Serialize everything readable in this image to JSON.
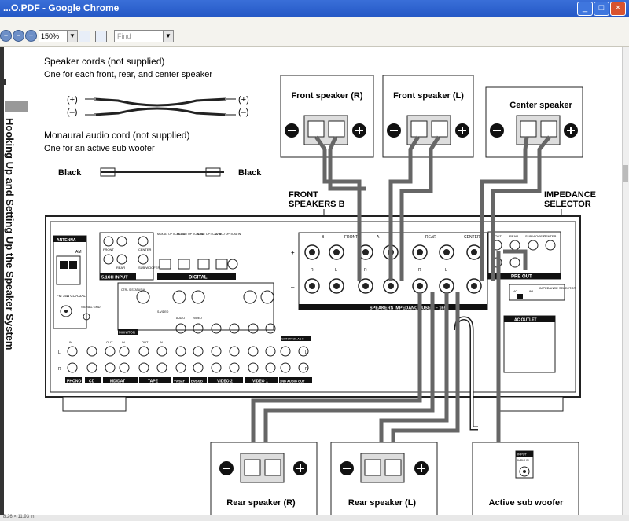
{
  "window": {
    "title": "...O.PDF - Google Chrome",
    "min": "_",
    "max": "□",
    "close": "×"
  },
  "toolbar": {
    "zoom": "150%",
    "find_placeholder": "Find",
    "page_size": "8.26 × 11.93 in"
  },
  "side_heading": "Hooking Up and Setting Up the Speaker System",
  "cords": {
    "speaker_title": "Speaker cords (not supplied)",
    "speaker_desc": "One for each front, rear, and center speaker",
    "plus": "(+)",
    "minus": "(–)",
    "mono_title": "Monaural audio cord (not supplied)",
    "mono_desc": "One for an active sub woofer",
    "black": "Black"
  },
  "speakers": {
    "front_r": "Front speaker (R)",
    "front_l": "Front speaker (L)",
    "center": "Center speaker",
    "rear_r": "Rear speaker (R)",
    "rear_l": "Rear speaker (L)",
    "sub": "Active sub woofer",
    "sub_input": "INPUT",
    "sub_audio": "AUDIO IN"
  },
  "callouts": {
    "front_b_1": "FRONT",
    "front_b_2": "SPEAKERS B",
    "imp_1": "IMPEDANCE",
    "imp_2": "SELECTOR"
  },
  "receiver": {
    "antenna": "ANTENNA",
    "am": "AM",
    "fm": "FM 75Ω COAXIAL",
    "input51": "5.1CH INPUT",
    "front": "FRONT",
    "rear": "REAR",
    "center": "CENTER",
    "sub": "SUB WOOFER",
    "digital": "DIGITAL",
    "opt1": "MD/DAT OPTICAL OUT",
    "opt2": "MD/DAT OPTICAL IN",
    "opt3": "TV/SAT OPTICAL IN",
    "opt4": "DVD/LD OPTICAL IN",
    "opt5": "DVD/LD COAXIAL IN",
    "monitor": "MONITOR",
    "signal_gnd": "SIGNAL GND",
    "ctrl_s": "CTRL S STATUS IN",
    "svideo": "S-VIDEO",
    "video": "VIDEO",
    "audio": "AUDIO",
    "in": "IN",
    "out": "OUT",
    "phono": "PHONO",
    "cd": "CD",
    "mddat": "MD/DAT",
    "tape": "TAPE",
    "tvsat": "TV/SAT",
    "dvdld": "DVD/LD",
    "video2": "VIDEO 2",
    "video1": "VIDEO 1",
    "audio2": "2ND AUDIO OUT",
    "control_a1": "CONTROL A1 II",
    "spk_b": "B",
    "spk_front": "FRONT",
    "spk_a": "A",
    "spk_rear": "REAR",
    "spk_center": "CENTER",
    "r": "R",
    "l": "L",
    "plus": "+",
    "minus": "–",
    "speakers_label": "SPEAKERS  IMPEDANCE USE 4 – 16Ω",
    "preout": "PRE OUT",
    "pre_front": "FRONT",
    "pre_rear": "REAR",
    "pre_sub": "SUB WOOFER",
    "pre_center": "CENTER",
    "impedance_selector": "IMPEDANCE SELECTOR",
    "imp_4": "4Ω",
    "imp_8": "8Ω",
    "ac_outlet": "AC OUTLET"
  }
}
